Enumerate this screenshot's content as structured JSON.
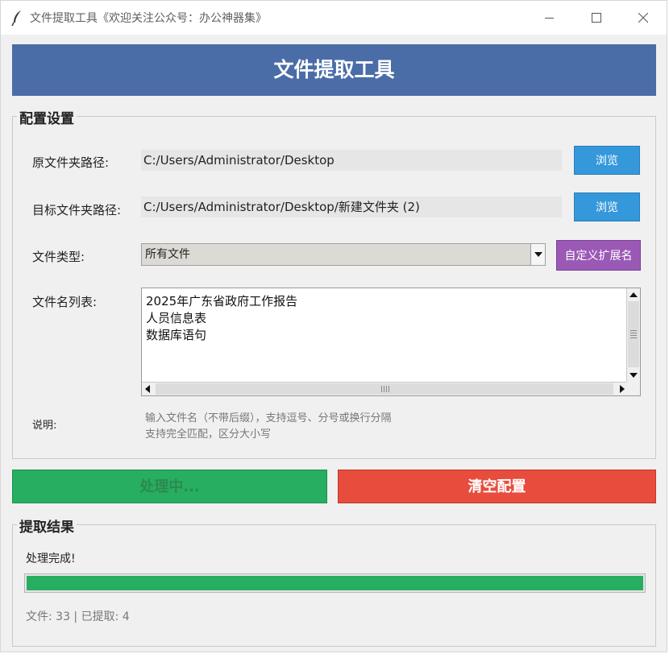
{
  "window": {
    "title": "文件提取工具《欢迎关注公众号：办公神器集》"
  },
  "header": {
    "title": "文件提取工具"
  },
  "config": {
    "group_title": "配置设置",
    "source": {
      "label": "原文件夹路径:",
      "value": "C:/Users/Administrator/Desktop",
      "browse_label": "浏览"
    },
    "target": {
      "label": "目标文件夹路径:",
      "value": "C:/Users/Administrator/Desktop/新建文件夹 (2)",
      "browse_label": "浏览"
    },
    "file_type": {
      "label": "文件类型:",
      "selected": "所有文件",
      "custom_ext_label": "自定义扩展名"
    },
    "file_list": {
      "label": "文件名列表:",
      "lines": [
        "2025年广东省政府工作报告",
        "人员信息表",
        "数据库语句"
      ]
    },
    "note": {
      "label": "说明:",
      "line1": "输入文件名（不带后缀），支持逗号、分号或换行分隔",
      "line2": "支持完全匹配，区分大小写"
    }
  },
  "actions": {
    "process_label": "处理中...",
    "clear_label": "清空配置"
  },
  "result": {
    "group_title": "提取结果",
    "status": "处理完成!",
    "progress_percent": 100,
    "stats": "文件: 33 | 已提取: 4"
  },
  "colors": {
    "header": "#4a6da7",
    "browse": "#3498db",
    "custom_ext": "#9b59b6",
    "process": "#27ae60",
    "clear": "#e74c3c"
  },
  "icons": {
    "title": "feather-icon",
    "minimize": "minimize-icon",
    "maximize": "maximize-icon",
    "close": "close-icon"
  }
}
